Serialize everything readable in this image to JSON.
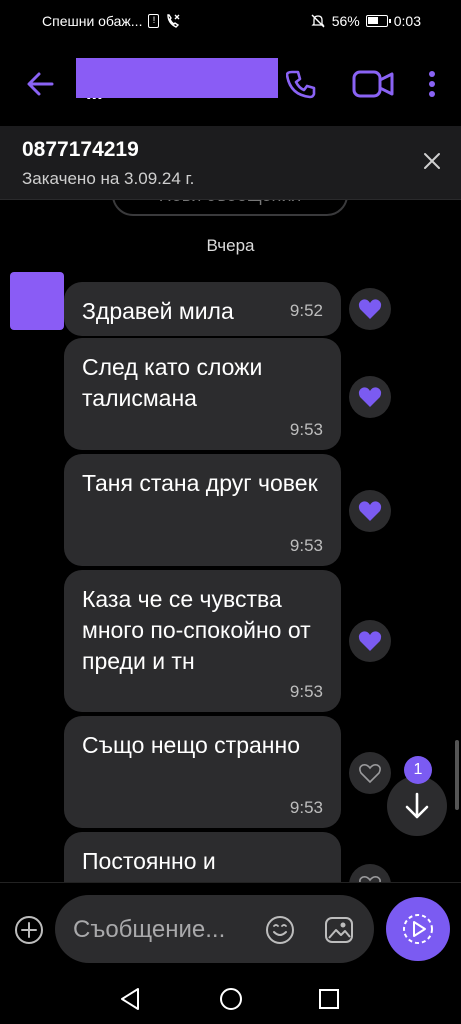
{
  "status_bar": {
    "carrier": "Спешни обаж...",
    "battery": "56%",
    "time": "0:03"
  },
  "header": {
    "contact_name_partial": "...",
    "icons": [
      "back-arrow-icon",
      "phone-icon",
      "video-call-icon",
      "more-vert-icon"
    ]
  },
  "pinned": {
    "phone": "0877174219",
    "pinned_text": "Закачено на 3.09.24 г."
  },
  "chat": {
    "new_messages_label": "Нови съобщения",
    "date_separator": "Вчера",
    "messages": [
      {
        "text": "Здравей мила",
        "time": "9:52",
        "liked": true
      },
      {
        "text": "След като сложи талисмана",
        "time": "9:53",
        "liked": true
      },
      {
        "text": "Таня стана друг човек",
        "time": "9:53",
        "liked": true
      },
      {
        "text": "Каза че се чувства много по-спокойно от преди и тн",
        "time": "9:53",
        "liked": true
      },
      {
        "text": "Също нещо странно",
        "time": "9:53",
        "liked": false
      },
      {
        "text": "Постоянно и",
        "time": "",
        "liked": false
      }
    ],
    "unread_count": "1"
  },
  "composer": {
    "placeholder": "Съобщение..."
  },
  "colors": {
    "accent": "#7b5bf2",
    "bubble": "#2c2c2e",
    "background": "#000000"
  }
}
